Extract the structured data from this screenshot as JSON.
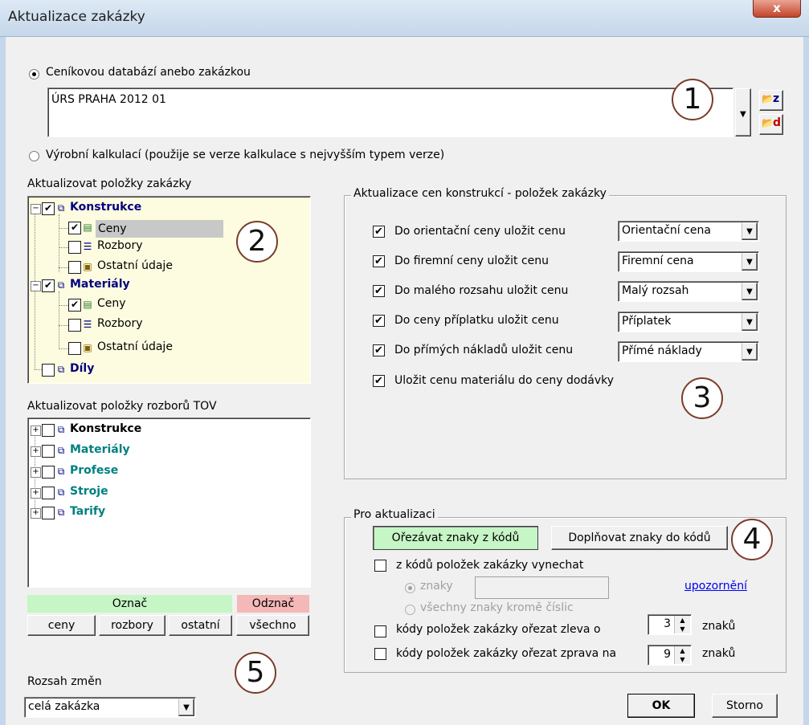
{
  "window": {
    "title": "Aktualizace zakázky",
    "close_label": "x"
  },
  "source": {
    "radio_db_label": "Ceníkovou databází anebo zakázkou",
    "db_value": "ÚRS PRAHA 2012 01",
    "btn_z_label": "z",
    "btn_d_label": "d",
    "radio_calc_label": "Výrobní kalkulací (použije se verze kalkulace s nejvyšším typem verze)"
  },
  "tree1": {
    "title": "Aktualizovat položky zakázky",
    "items": [
      {
        "label": "Konstrukce",
        "checked": true
      },
      {
        "label": "Ceny",
        "checked": true
      },
      {
        "label": "Rozbory",
        "checked": false
      },
      {
        "label": "Ostatní údaje",
        "checked": false
      },
      {
        "label": "Materiály",
        "checked": true
      },
      {
        "label": "Ceny",
        "checked": true
      },
      {
        "label": "Rozbory",
        "checked": false
      },
      {
        "label": "Ostatní údaje",
        "checked": false
      },
      {
        "label": "Díly",
        "checked": false
      }
    ]
  },
  "tree2": {
    "title": "Aktualizovat položky rozborů TOV",
    "items": [
      {
        "label": "Konstrukce",
        "checked": false
      },
      {
        "label": "Materiály",
        "checked": false
      },
      {
        "label": "Profese",
        "checked": false
      },
      {
        "label": "Stroje",
        "checked": false
      },
      {
        "label": "Tarify",
        "checked": false
      }
    ]
  },
  "mark": {
    "mark_label": "Označ",
    "unmark_label": "Odznač",
    "buttons": [
      "ceny",
      "rozbory",
      "ostatní",
      "všechno"
    ]
  },
  "scope": {
    "label": "Rozsah změn",
    "value": "celá zakázka"
  },
  "prices": {
    "legend": "Aktualizace cen konstrukcí - položek zakázky",
    "rows": [
      {
        "label": "Do orientační ceny uložit cenu",
        "checked": true,
        "value": "Orientační cena"
      },
      {
        "label": "Do firemní ceny uložit cenu",
        "checked": true,
        "value": "Firemní cena"
      },
      {
        "label": "Do malého rozsahu uložit cenu",
        "checked": true,
        "value": "Malý rozsah"
      },
      {
        "label": "Do ceny příplatku uložit cenu",
        "checked": true,
        "value": "Příplatek"
      },
      {
        "label": "Do přímých nákladů uložit cenu",
        "checked": true,
        "value": "Přímé náklady"
      }
    ],
    "material_label": "Uložit cenu materiálu do ceny dodávky",
    "material_checked": true
  },
  "update": {
    "legend": "Pro aktualizaci",
    "btn_trim": "Ořezávat znaky z kódů",
    "btn_fill": "Doplňovat znaky do kódů",
    "omit_label": "z kódů položek zakázky vynechat",
    "radio_chars": "znaky",
    "radio_all": "všechny znaky kromě číslic",
    "warning_link": "upozornění",
    "left_label": "kódy položek zakázky ořezat zleva o",
    "left_value": "3",
    "right_label": "kódy položek zakázky ořezat zprava na",
    "right_value": "9",
    "unit": "znaků"
  },
  "footer": {
    "ok": "OK",
    "cancel": "Storno"
  },
  "callouts": [
    "1",
    "2",
    "3",
    "4",
    "5"
  ],
  "colors": {
    "mark_bg": "#c6f5c6",
    "unmark_bg": "#f5b8b8",
    "tree_bg": "#fdfce0",
    "callout_border": "#7a3d2a",
    "link": "#0000ee"
  }
}
